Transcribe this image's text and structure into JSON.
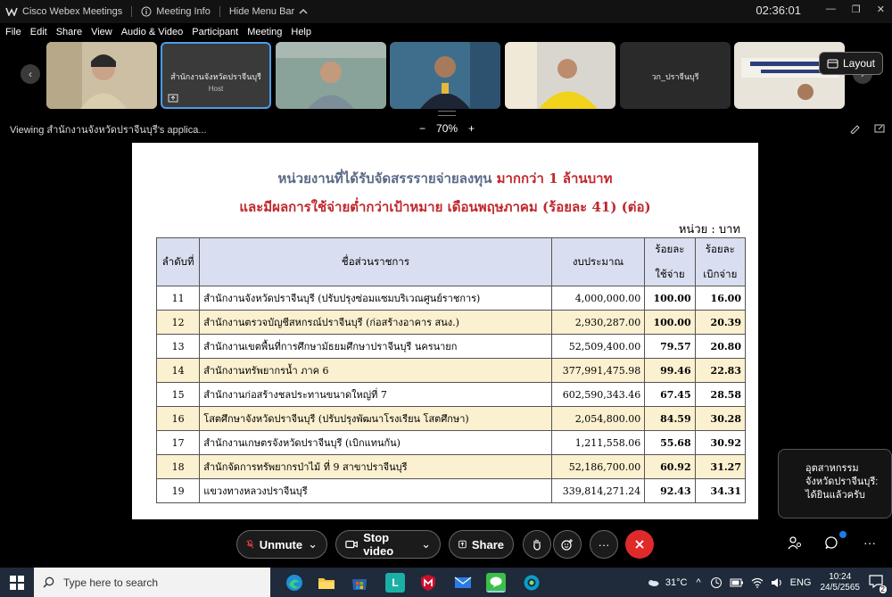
{
  "titlebar": {
    "app_name": "Cisco Webex Meetings",
    "meeting_info": "Meeting Info",
    "hide_menu": "Hide Menu Bar",
    "clock": "02:36:01"
  },
  "menu": [
    "File",
    "Edit",
    "Share",
    "View",
    "Audio & Video",
    "Participant",
    "Meeting",
    "Help"
  ],
  "participants": [
    {
      "name": ""
    },
    {
      "name": "สำนักงานจังหวัดปราจีนบุรี",
      "role": "Host"
    },
    {
      "name": ""
    },
    {
      "name": ""
    },
    {
      "name": ""
    },
    {
      "name": "วก_ปราจีนบุรี"
    },
    {
      "name": ""
    }
  ],
  "layout_button": "Layout",
  "viewing": {
    "text": "Viewing สำนักงานจังหวัดปราจีนบุรี's applica...",
    "zoom": "70%",
    "minus": "−",
    "plus": "+"
  },
  "document": {
    "title1_main": "หน่วยงานที่ได้รับจัดสรรรายจ่ายลงทุน ",
    "title1_hl": "มากกว่า 1 ล้านบาท",
    "title2": "และมีผลการใช้จ่ายต่ำกว่าเป้าหมาย เดือนพฤษภาคม (ร้อยละ 41) (ต่อ)",
    "unit": "หน่วย : บาท",
    "headers": {
      "no": "ลำดับที่",
      "name": "ชื่อส่วนราชการ",
      "budget": "งบประมาณ",
      "p1_line1": "ร้อยละ",
      "p1_line2": "ใช้จ่าย",
      "p2_line1": "ร้อยละ",
      "p2_line2": "เบิกจ่าย"
    },
    "rows": [
      {
        "no": "11",
        "name": "สำนักงานจังหวัดปราจีนบุรี (ปรับปรุงซ่อมแซมบริเวณศูนย์ราชการ)",
        "budget": "4,000,000.00",
        "p1": "100.00",
        "p2": "16.00"
      },
      {
        "no": "12",
        "name": "สำนักงานตรวจบัญชีสหกรณ์ปราจีนบุรี  (ก่อสร้างอาคาร สนง.)",
        "budget": "2,930,287.00",
        "p1": "100.00",
        "p2": "20.39"
      },
      {
        "no": "13",
        "name": "สำนักงานเขตพื้นที่การศึกษามัธยมศึกษาปราจีนบุรี นครนายก",
        "budget": "52,509,400.00",
        "p1": "79.57",
        "p2": "20.80"
      },
      {
        "no": "14",
        "name": "สำนักงานทรัพยากรน้ำ ภาค 6",
        "budget": "377,991,475.98",
        "p1": "99.46",
        "p2": "22.83"
      },
      {
        "no": "15",
        "name": "สำนักงานก่อสร้างชลประทานขนาดใหญ่ที่ 7",
        "budget": "602,590,343.46",
        "p1": "67.45",
        "p2": "28.58"
      },
      {
        "no": "16",
        "name": "โสตศึกษาจังหวัดปราจีนบุรี (ปรับปรุงพัฒนาโรงเรียน โสตศึกษา)",
        "budget": "2,054,800.00",
        "p1": "84.59",
        "p2": "30.28"
      },
      {
        "no": "17",
        "name": "สำนักงานเกษตรจังหวัดปราจีนบุรี (เบิกแทนกัน)",
        "budget": "1,211,558.06",
        "p1": "55.68",
        "p2": "30.92"
      },
      {
        "no": "18",
        "name": "สำนักจัดการทรัพยากรป่าไม้ ที่ 9 สาขาปราจีนบุรี",
        "budget": "52,186,700.00",
        "p1": "60.92",
        "p2": "31.27"
      },
      {
        "no": "19",
        "name": "แขวงทางหลวงปราจีนบุรี",
        "budget": "339,814,271.24",
        "p1": "92.43",
        "p2": "34.31"
      }
    ]
  },
  "chat_popup": {
    "sender": "อุตสาหกรรมจังหวัดปราจีนบุรี:",
    "message": "ได้ยินแล้วครับ"
  },
  "controls": {
    "unmute": "Unmute",
    "stop_video": "Stop video",
    "share": "Share",
    "more": "···"
  },
  "taskbar": {
    "search_placeholder": "Type here to search",
    "temperature": "31°C",
    "language": "ENG",
    "time": "10:24",
    "date": "24/5/2565",
    "notifications": "2"
  },
  "colors": {
    "accent": "#4c9de8",
    "leave_red": "#e02a2a",
    "doc_red": "#c0282d",
    "header_fill": "#d9dff0",
    "alt_row_fill": "#fbf0cf"
  }
}
